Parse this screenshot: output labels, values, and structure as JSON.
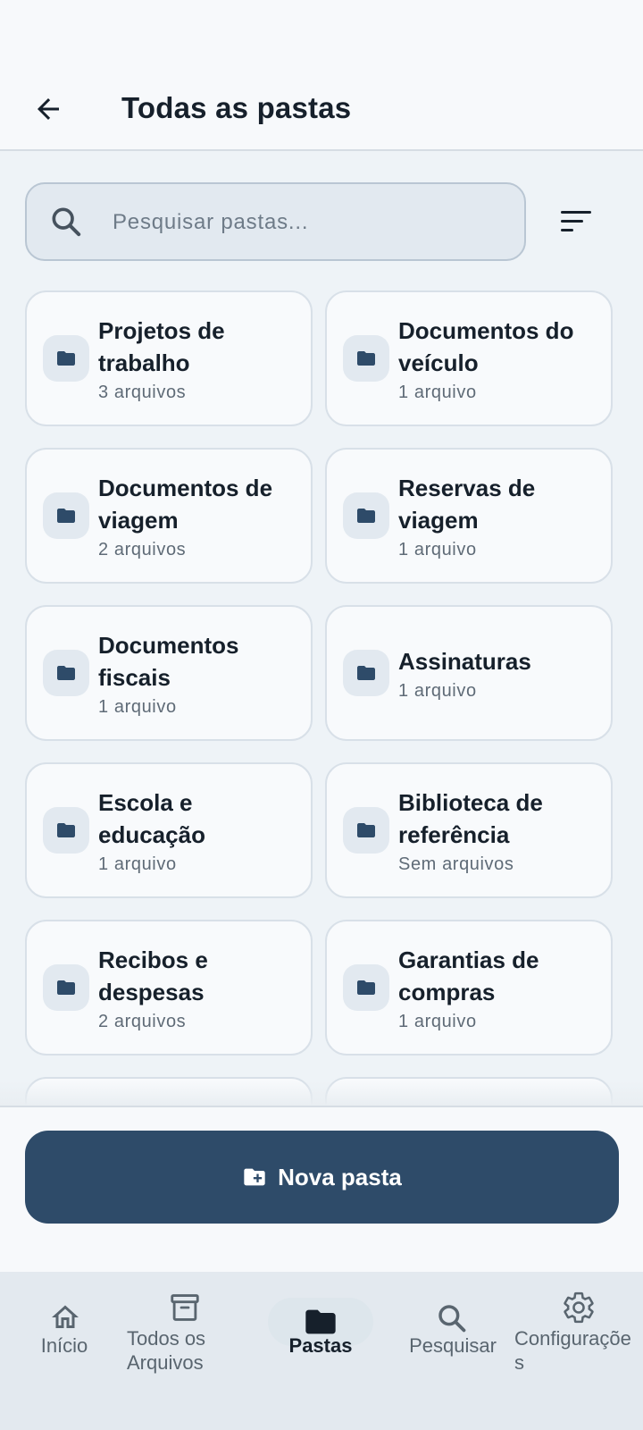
{
  "app_bar": {
    "title": "Todas as pastas"
  },
  "search": {
    "placeholder": "Pesquisar pastas..."
  },
  "folders": [
    {
      "name": "Projetos de trabalho",
      "count": "3 arquivos"
    },
    {
      "name": "Documentos do veículo",
      "count": "1 arquivo"
    },
    {
      "name": "Documentos de viagem",
      "count": "2 arquivos"
    },
    {
      "name": "Reservas de viagem",
      "count": "1 arquivo"
    },
    {
      "name": "Documentos fiscais",
      "count": "1 arquivo"
    },
    {
      "name": "Assinaturas",
      "count": "1 arquivo"
    },
    {
      "name": "Escola e educação",
      "count": "1 arquivo"
    },
    {
      "name": "Biblioteca de referência",
      "count": "Sem arquivos"
    },
    {
      "name": "Recibos e despesas",
      "count": "2 arquivos"
    },
    {
      "name": "Garantias de compras",
      "count": "1 arquivo"
    }
  ],
  "footer": {
    "new_folder_label": "Nova pasta"
  },
  "nav": {
    "home": "Início",
    "all_files": "Todos os Arquivos",
    "folders": "Pastas",
    "search": "Pesquisar",
    "settings": "Configuraçõe s"
  },
  "colors": {
    "primary": "#2e4b69",
    "background": "#eef3f7",
    "card": "#f8fafc",
    "nav": "#e3e9ef"
  }
}
